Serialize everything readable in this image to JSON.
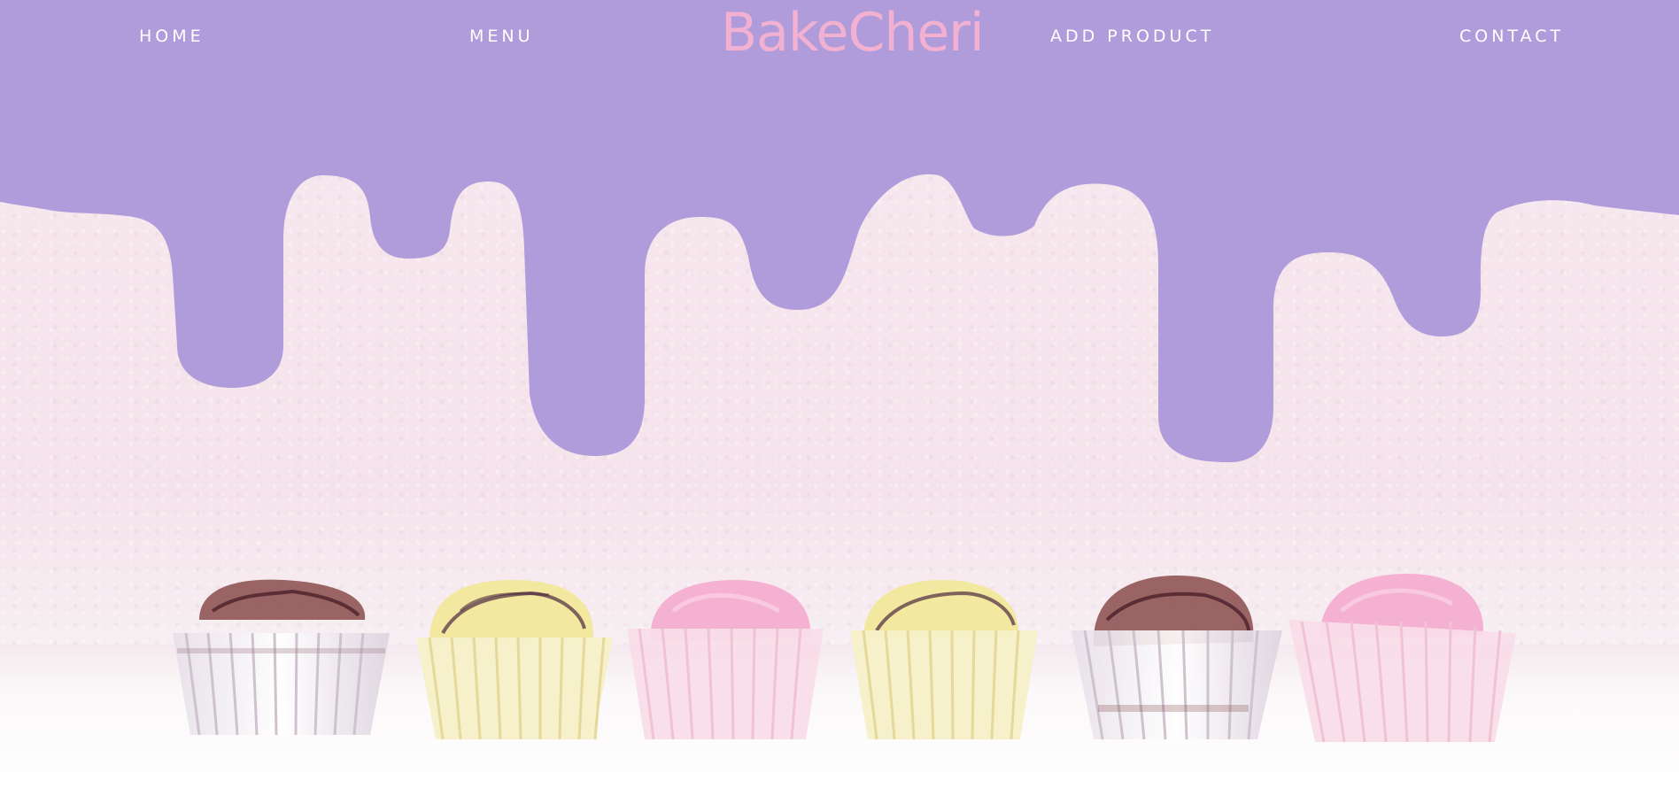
{
  "brand": {
    "name": "BakeCheri",
    "color": "#f2b1d0"
  },
  "nav": {
    "items": [
      {
        "label": "HOME"
      },
      {
        "label": "MENU"
      },
      {
        "label": "ADD PRODUCT"
      },
      {
        "label": "CONTACT"
      }
    ]
  },
  "hero": {
    "drip_color": "#b09cdb",
    "background_color": "#f7e8ee",
    "cupcake_flavors": [
      "chocolate",
      "vanilla",
      "strawberry",
      "vanilla",
      "chocolate",
      "strawberry"
    ],
    "flavor_colors": {
      "chocolate": "#7a3b3a",
      "vanilla": "#f4e9a6",
      "strawberry": "#f3a9cc"
    }
  }
}
